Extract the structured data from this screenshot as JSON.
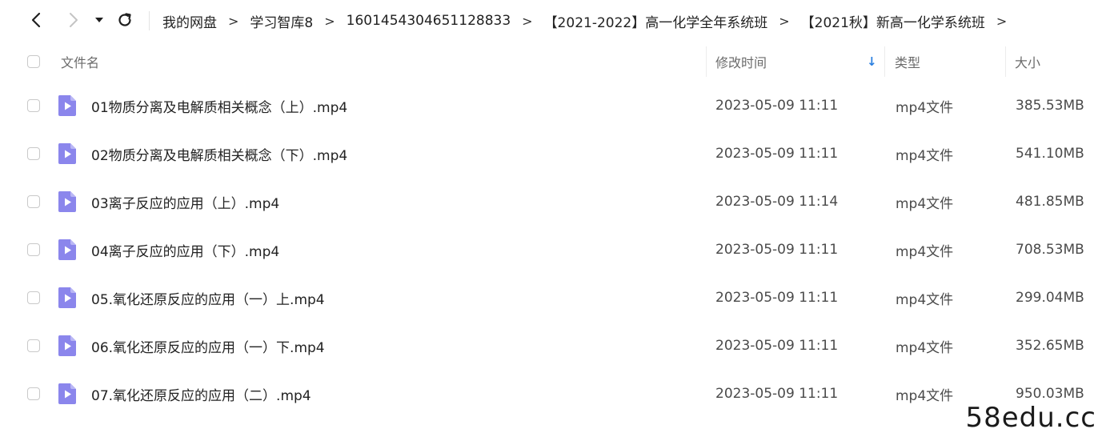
{
  "breadcrumb": [
    "我的网盘",
    "学习智库8",
    "1601454304651128833",
    "【2021-2022】高一化学全年系统班",
    "【2021秋】新高一化学系统班"
  ],
  "breadcrumb_sep": ">",
  "columns": {
    "name": "文件名",
    "modified": "修改时间",
    "type": "类型",
    "size": "大小"
  },
  "sort_indicator": "↓",
  "files": [
    {
      "name": "01物质分离及电解质相关概念（上）.mp4",
      "modified": "2023-05-09 11:11",
      "type": "mp4文件",
      "size": "385.53MB"
    },
    {
      "name": "02物质分离及电解质相关概念（下）.mp4",
      "modified": "2023-05-09 11:11",
      "type": "mp4文件",
      "size": "541.10MB"
    },
    {
      "name": "03离子反应的应用（上）.mp4",
      "modified": "2023-05-09 11:14",
      "type": "mp4文件",
      "size": "481.85MB"
    },
    {
      "name": "04离子反应的应用（下）.mp4",
      "modified": "2023-05-09 11:11",
      "type": "mp4文件",
      "size": "708.53MB"
    },
    {
      "name": "05.氧化还原反应的应用（一）上.mp4",
      "modified": "2023-05-09 11:11",
      "type": "mp4文件",
      "size": "299.04MB"
    },
    {
      "name": "06.氧化还原反应的应用（一）下.mp4",
      "modified": "2023-05-09 11:11",
      "type": "mp4文件",
      "size": "352.65MB"
    },
    {
      "name": "07.氧化还原反应的应用（二）.mp4",
      "modified": "2023-05-09 11:11",
      "type": "mp4文件",
      "size": "950.03MB"
    }
  ],
  "icons": {
    "back": "chevron-left-icon",
    "forward": "chevron-right-icon",
    "history": "caret-down-icon",
    "refresh": "refresh-icon",
    "file": "video-file-icon"
  },
  "colors": {
    "file_icon": "#8b86ec",
    "sort_arrow": "#2a7fe0"
  },
  "watermark": "58edu.cc"
}
